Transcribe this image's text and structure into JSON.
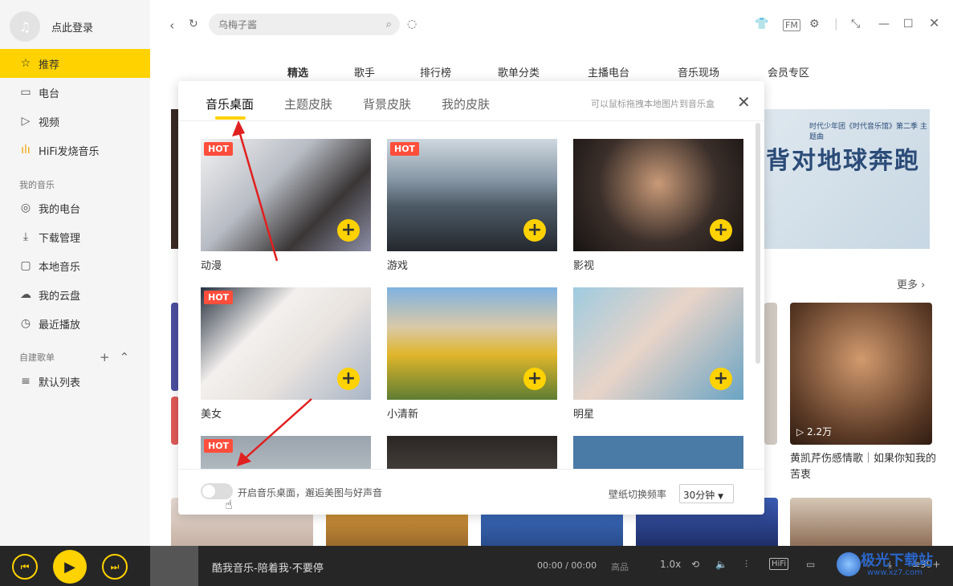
{
  "sidebar": {
    "login": "点此登录",
    "items": [
      {
        "label": "推荐",
        "icon": "star-icon"
      },
      {
        "label": "电台",
        "icon": "radio-icon"
      },
      {
        "label": "视频",
        "icon": "video-icon"
      },
      {
        "label": "HiFi发烧音乐",
        "icon": "hifi-icon"
      }
    ],
    "my_music_title": "我的音乐",
    "my_music": [
      {
        "label": "我的电台",
        "icon": "location-icon"
      },
      {
        "label": "下载管理",
        "icon": "download-icon"
      },
      {
        "label": "本地音乐",
        "icon": "monitor-icon"
      },
      {
        "label": "我的云盘",
        "icon": "cloud-icon"
      },
      {
        "label": "最近播放",
        "icon": "clock-icon"
      }
    ],
    "playlist_title": "自建歌单",
    "playlists": [
      {
        "label": "默认列表",
        "icon": "list-icon"
      }
    ]
  },
  "topbar": {
    "search_placeholder": "乌梅子酱",
    "nav_tabs": [
      "精选",
      "歌手",
      "排行榜",
      "歌单分类",
      "主播电台",
      "音乐现场",
      "会员专区"
    ]
  },
  "content": {
    "more": "更多",
    "banner_title": "背对地球奔跑",
    "banner_sub": "时代少年团《时代音乐馆》第二季 主题曲",
    "right_card_plays": "2.2万",
    "right_card_title": "黄凯芹伤感情歌｜如果你知我的苦衷"
  },
  "modal": {
    "tabs": [
      "音乐桌面",
      "主题皮肤",
      "背景皮肤",
      "我的皮肤"
    ],
    "hint": "可以鼠标拖拽本地图片到音乐盒",
    "hot": "HOT",
    "items": [
      {
        "label": "动漫",
        "hot": true
      },
      {
        "label": "游戏",
        "hot": true
      },
      {
        "label": "影视",
        "hot": false
      },
      {
        "label": "美女",
        "hot": true
      },
      {
        "label": "小清新",
        "hot": false
      },
      {
        "label": "明星",
        "hot": false
      }
    ],
    "toggle_text": "开启音乐桌面，邂逅美图与好声音",
    "rate_label": "壁纸切换频率",
    "rate_value": "30分钟"
  },
  "player": {
    "title": "酷我音乐-陪着我·不要停",
    "time": "00:00 / 00:00",
    "quality": "高品",
    "speed": "1.0x",
    "hifi": "HiFi",
    "lyrics": "词",
    "count": "99+"
  },
  "watermark": {
    "text": "极光下载站",
    "url": "www.xz7.com"
  },
  "colors": {
    "accent": "#ffd200",
    "hot": "#ff4e3c",
    "arrow": "#e02020",
    "player_bg": "#262626"
  }
}
